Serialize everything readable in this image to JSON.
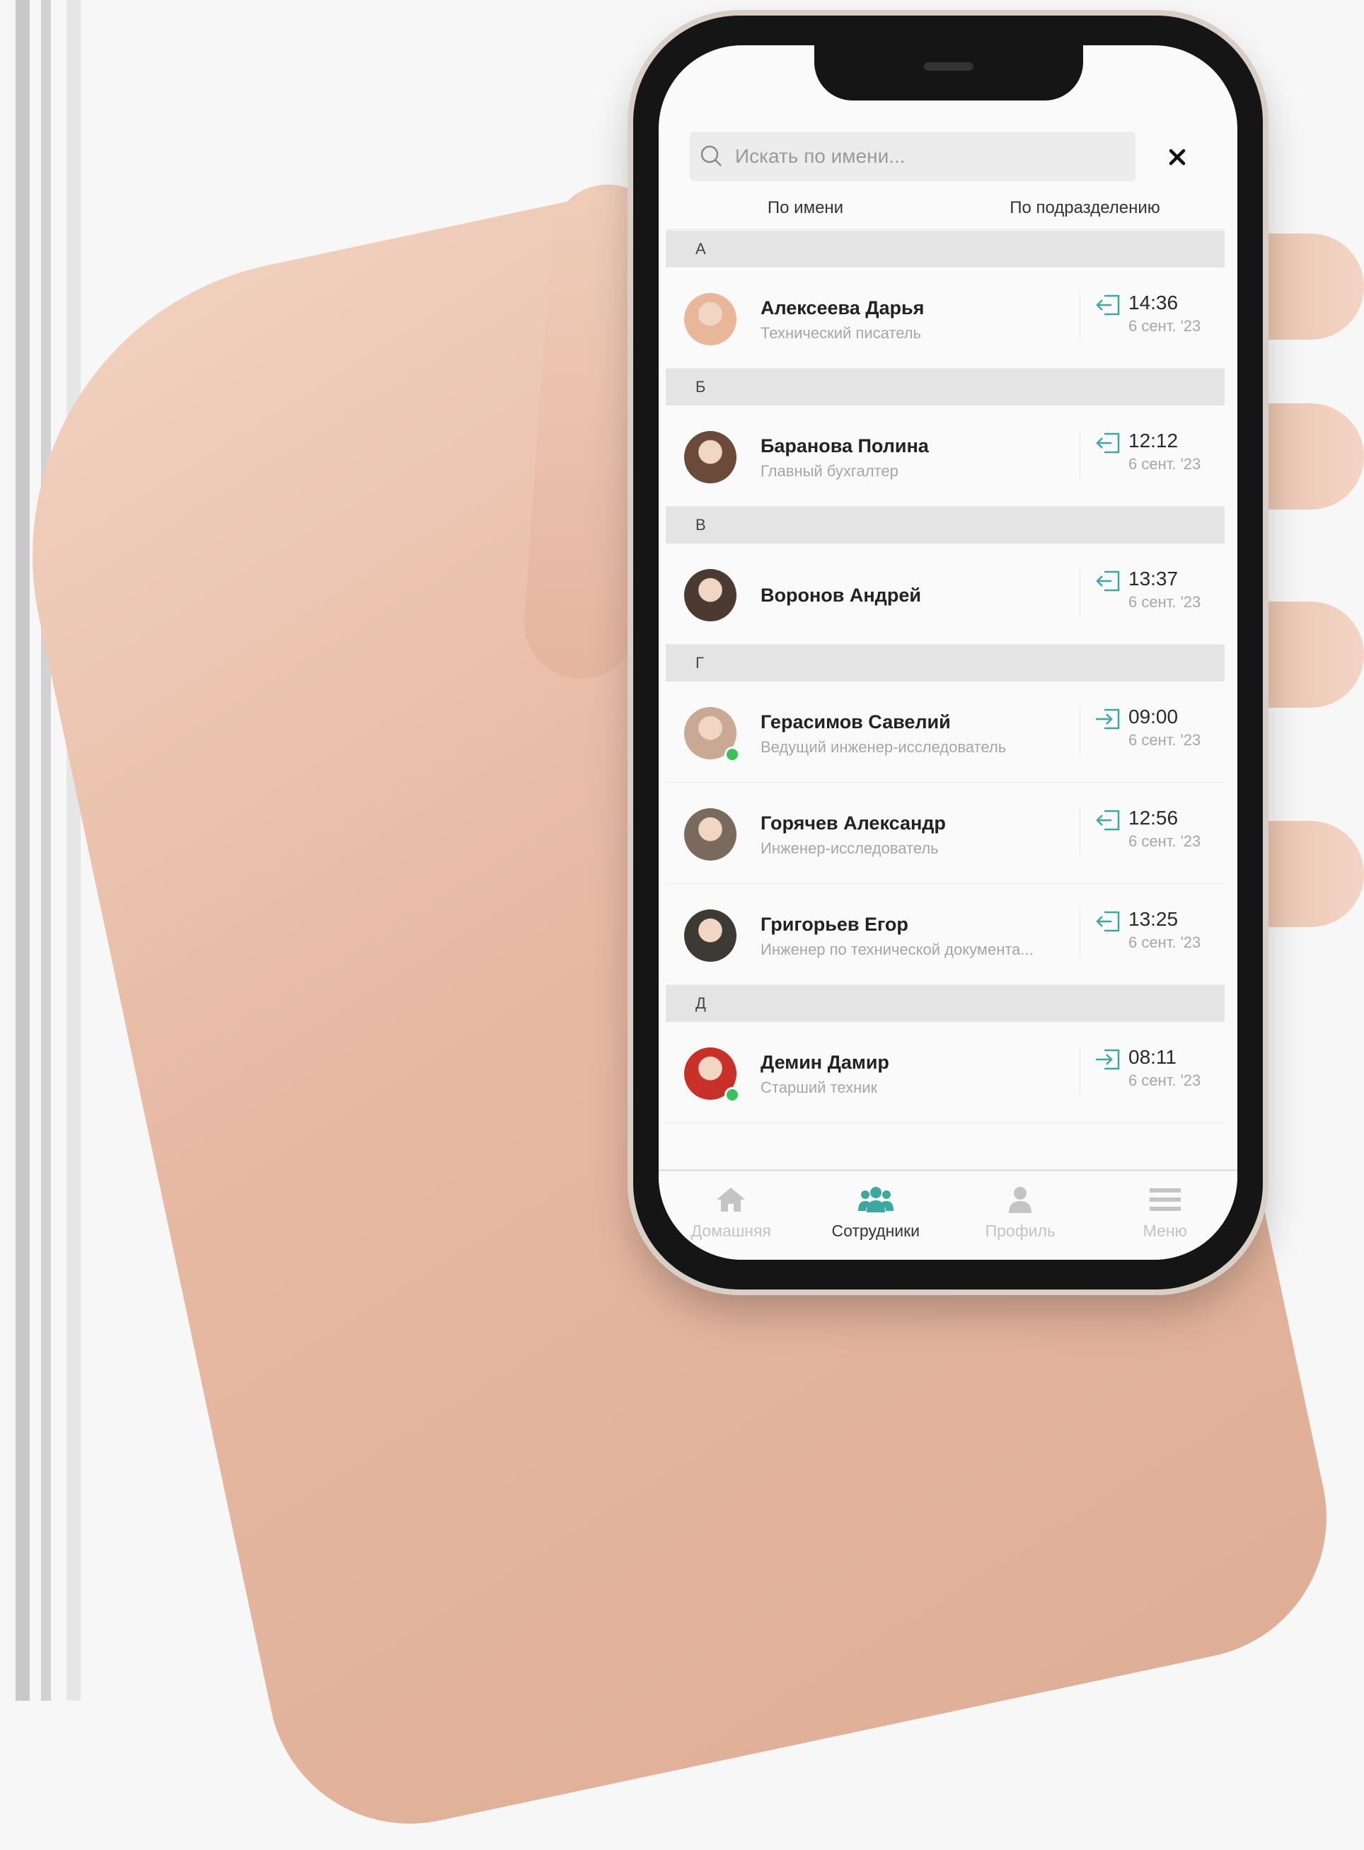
{
  "search": {
    "placeholder": "Искать по имени...",
    "value": ""
  },
  "tabs": [
    {
      "label": "По имени",
      "active": true
    },
    {
      "label": "По подразделению",
      "active": false
    }
  ],
  "sections": [
    {
      "letter": "А",
      "employees": [
        {
          "name": "Алексеева Дарья",
          "role": "Технический писатель",
          "direction": "exit",
          "time": "14:36",
          "date": "6 сент. '23",
          "online": false,
          "avatar_color": "#e8b79a"
        }
      ]
    },
    {
      "letter": "Б",
      "employees": [
        {
          "name": "Баранова Полина",
          "role": "Главный бухгалтер",
          "direction": "exit",
          "time": "12:12",
          "date": "6 сент. '23",
          "online": false,
          "avatar_color": "#6b4a3a"
        }
      ]
    },
    {
      "letter": "В",
      "employees": [
        {
          "name": "Воронов Андрей",
          "role": "",
          "direction": "exit",
          "time": "13:37",
          "date": "6 сент. '23",
          "online": false,
          "avatar_color": "#4a3a30"
        }
      ]
    },
    {
      "letter": "Г",
      "employees": [
        {
          "name": "Герасимов Савелий",
          "role": "Ведущий инженер-исследователь",
          "direction": "enter",
          "time": "09:00",
          "date": "6 сент. '23",
          "online": true,
          "avatar_color": "#c9a894"
        },
        {
          "name": "Горячев Александр",
          "role": "Инженер-исследователь",
          "direction": "exit",
          "time": "12:56",
          "date": "6 сент. '23",
          "online": false,
          "avatar_color": "#7a6a5e"
        },
        {
          "name": "Григорьев Егор",
          "role": "Инженер по технической документа...",
          "direction": "exit",
          "time": "13:25",
          "date": "6 сент. '23",
          "online": false,
          "avatar_color": "#3d3a36"
        }
      ]
    },
    {
      "letter": "Д",
      "employees": [
        {
          "name": "Демин Дамир",
          "role": "Старший техник",
          "direction": "enter",
          "time": "08:11",
          "date": "6 сент. '23",
          "online": true,
          "avatar_color": "#c8302a"
        }
      ]
    }
  ],
  "nav": [
    {
      "label": "Домашняя",
      "icon": "home-icon",
      "active": false
    },
    {
      "label": "Сотрудники",
      "icon": "people-icon",
      "active": true
    },
    {
      "label": "Профиль",
      "icon": "person-icon",
      "active": false
    },
    {
      "label": "Меню",
      "icon": "menu-icon",
      "active": false
    }
  ],
  "colors": {
    "accent": "#3ba9a0",
    "online": "#3cc15a",
    "nav_inactive": "#c4c4c4"
  }
}
